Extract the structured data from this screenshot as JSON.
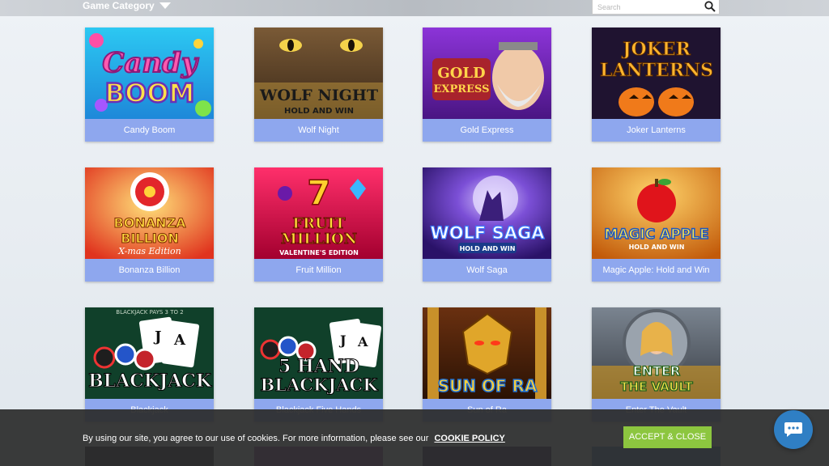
{
  "header": {
    "category_label": "Game Category",
    "search_placeholder": "Search"
  },
  "games": [
    {
      "title": "Candy Boom",
      "art_text": "Candy",
      "art_text2": "BOOM"
    },
    {
      "title": "Wolf Night",
      "art_text": "WOLF NIGHT",
      "art_text2": "HOLD AND WIN"
    },
    {
      "title": "Gold Express",
      "art_text": "GOLD",
      "art_text2": "EXPRESS"
    },
    {
      "title": "Joker Lanterns",
      "art_text": "JOKER",
      "art_text2": "LANTERNS"
    },
    {
      "title": "Bonanza Billion",
      "art_text": "BONANZA",
      "art_text2": "BILLION",
      "art_text3": "X-mas Edition"
    },
    {
      "title": "Fruit Million",
      "art_text": "FRUIT",
      "art_text2": "MILLION",
      "art_text3": "VALENTINE'S EDITION"
    },
    {
      "title": "Wolf Saga",
      "art_text": "WOLF SAGA",
      "art_text2": "HOLD AND WIN"
    },
    {
      "title": "Magic Apple: Hold and Win",
      "art_text": "MAGIC APPLE",
      "art_text2": "HOLD AND WIN"
    },
    {
      "title": "Blackjack",
      "art_text": "BLACKJACK",
      "art_text2": "BLACKJACK PAYS 3 TO 2"
    },
    {
      "title": "Blackjack Five Hands",
      "art_text": "5 HAND",
      "art_text2": "BLACKJACK"
    },
    {
      "title": "Sun of Ra",
      "art_text": "SUN OF RA"
    },
    {
      "title": "Enter The Vault",
      "art_text": "ENTER",
      "art_text2": "THE VAULT"
    }
  ],
  "cookie": {
    "message": "By using our site, you agree to our use of cookies. For more information, please see our",
    "policy_link": "COOKIE POLICY",
    "accept_label": "ACCEPT & CLOSE"
  },
  "colors": {
    "label_bg": "#8ea7ee",
    "accept_bg": "#8cc63f",
    "chat_bg": "#2f7fc4",
    "cookie_bg": "#2c2c2c"
  },
  "icons": {
    "search": "search-icon",
    "dropdown": "chevron-down-icon",
    "chat": "chat-bubble-icon"
  }
}
